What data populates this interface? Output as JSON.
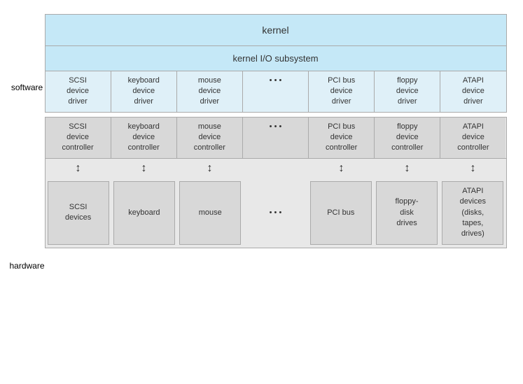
{
  "diagram": {
    "software_label": "software",
    "hardware_label": "hardware",
    "kernel": "kernel",
    "kernel_io": "kernel I/O subsystem",
    "drivers": [
      {
        "id": "scsi-driver",
        "text": "SCSI\ndevice\ndriver"
      },
      {
        "id": "keyboard-driver",
        "text": "keyboard\ndevice\ndriver"
      },
      {
        "id": "mouse-driver",
        "text": "mouse\ndevice\ndriver"
      },
      {
        "id": "ellipsis-driver",
        "text": "• • •"
      },
      {
        "id": "pci-driver",
        "text": "PCI bus\ndevice\ndriver"
      },
      {
        "id": "floppy-driver",
        "text": "floppy\ndevice\ndriver"
      },
      {
        "id": "atapi-driver",
        "text": "ATAPI\ndevice\ndriver"
      }
    ],
    "controllers": [
      {
        "id": "scsi-controller",
        "text": "SCSI\ndevice\ncontroller"
      },
      {
        "id": "keyboard-controller",
        "text": "keyboard\ndevice\ncontroller"
      },
      {
        "id": "mouse-controller",
        "text": "mouse\ndevice\ncontroller"
      },
      {
        "id": "ellipsis-controller",
        "text": "• • •"
      },
      {
        "id": "pci-controller",
        "text": "PCI bus\ndevice\ncontroller"
      },
      {
        "id": "floppy-controller",
        "text": "floppy\ndevice\ncontroller"
      },
      {
        "id": "atapi-controller",
        "text": "ATAPI\ndevice\ncontroller"
      }
    ],
    "devices": [
      {
        "id": "scsi-devices",
        "text": "SCSI\ndevices"
      },
      {
        "id": "keyboard-device",
        "text": "keyboard"
      },
      {
        "id": "mouse-device",
        "text": "mouse"
      },
      {
        "id": "ellipsis-device",
        "text": "• • •"
      },
      {
        "id": "pci-device",
        "text": "PCI bus"
      },
      {
        "id": "floppy-device",
        "text": "floppy-\ndisk\ndrives"
      },
      {
        "id": "atapi-device",
        "text": "ATAPI\ndevices\n(disks,\ntapes,\ndrives)"
      }
    ]
  }
}
